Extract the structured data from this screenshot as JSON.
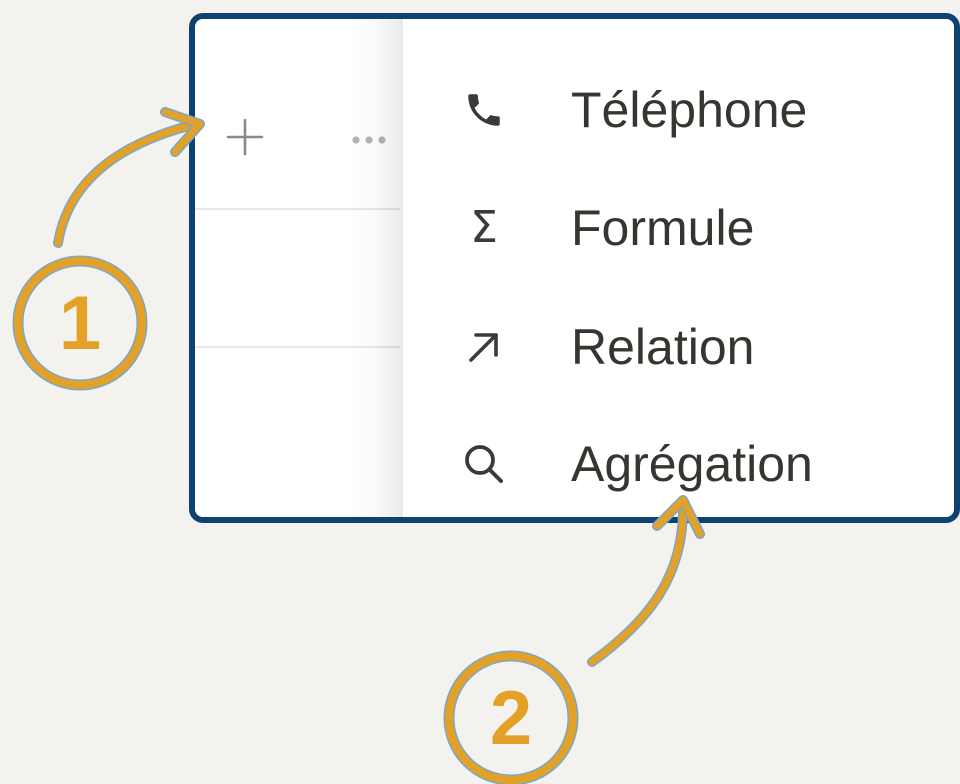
{
  "table": {
    "add_column_icon": "plus-icon",
    "more_icon": "more-horizontal-icon"
  },
  "menu": {
    "items": [
      {
        "label": "Téléphone",
        "icon": "phone-icon"
      },
      {
        "label": "Formule",
        "icon": "sigma-icon"
      },
      {
        "label": "Relation",
        "icon": "arrow-up-right-icon"
      },
      {
        "label": "Agrégation",
        "icon": "search-icon"
      }
    ]
  },
  "annotations": {
    "steps": [
      {
        "number": "1",
        "points_to": "add-column-button"
      },
      {
        "number": "2",
        "points_to": "menu-item-agregation"
      }
    ]
  },
  "colors": {
    "frame_border": "#0e4270",
    "annotation_accent": "#e3a127",
    "annotation_outline": "#7aa7c8",
    "background": "#f3f2ef",
    "text": "#37352f"
  }
}
